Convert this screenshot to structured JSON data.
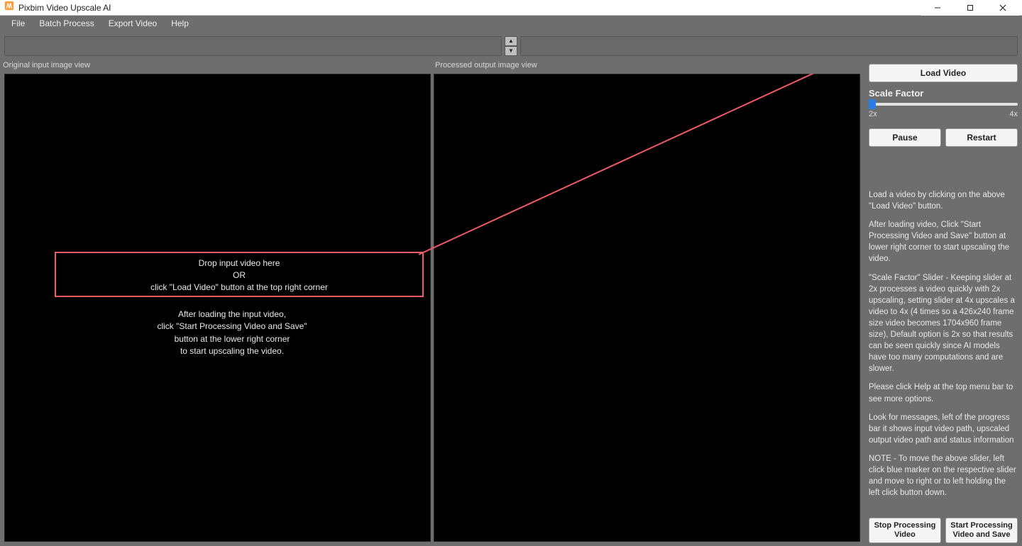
{
  "title": "Pixbim Video Upscale AI",
  "menu": {
    "file": "File",
    "batch": "Batch Process",
    "export": "Export Video",
    "help": "Help"
  },
  "panels": {
    "left_label": "Original input image view",
    "right_label": "Processed output image view"
  },
  "callout": {
    "line1": "Drop input video here",
    "line2": "OR",
    "line3": "click \"Load Video\" button at the top right corner"
  },
  "afterload": {
    "l1": "After loading the input video,",
    "l2": "click \"Start Processing Video and Save\"",
    "l3": "button at the lower right corner",
    "l4": "to start upscaling the video."
  },
  "right": {
    "load_video": "Load Video",
    "scale_factor_label": "Scale Factor",
    "tick_min": "2x",
    "tick_max": "4x",
    "pause": "Pause",
    "restart": "Restart",
    "stop": "Stop Processing Video",
    "start": "Start Processing Video and Save",
    "info_p1": "Load a video by clicking on the above \"Load Video\" button.",
    "info_p2": "After loading video, Click \"Start Processing Video and Save\" button at lower right corner to start upscaling the video.",
    "info_p3": "\"Scale Factor\" Slider - Keeping slider at 2x processes a video quickly with 2x upscaling, setting slider at 4x upscales a video to 4x (4 times so a 426x240 frame size video becomes 1704x960 frame size), Default option is 2x so that results can be seen quickly since AI models have too many computations and are slower.",
    "info_p4": "Please click Help at the top menu bar to see more options.",
    "info_p5": "Look for messages, left of the progress bar it shows input video path, upscaled output video path and status information",
    "info_p6": "NOTE - To move the above slider, left click blue marker on the respective slider and move to right or to left holding the left click button down."
  }
}
